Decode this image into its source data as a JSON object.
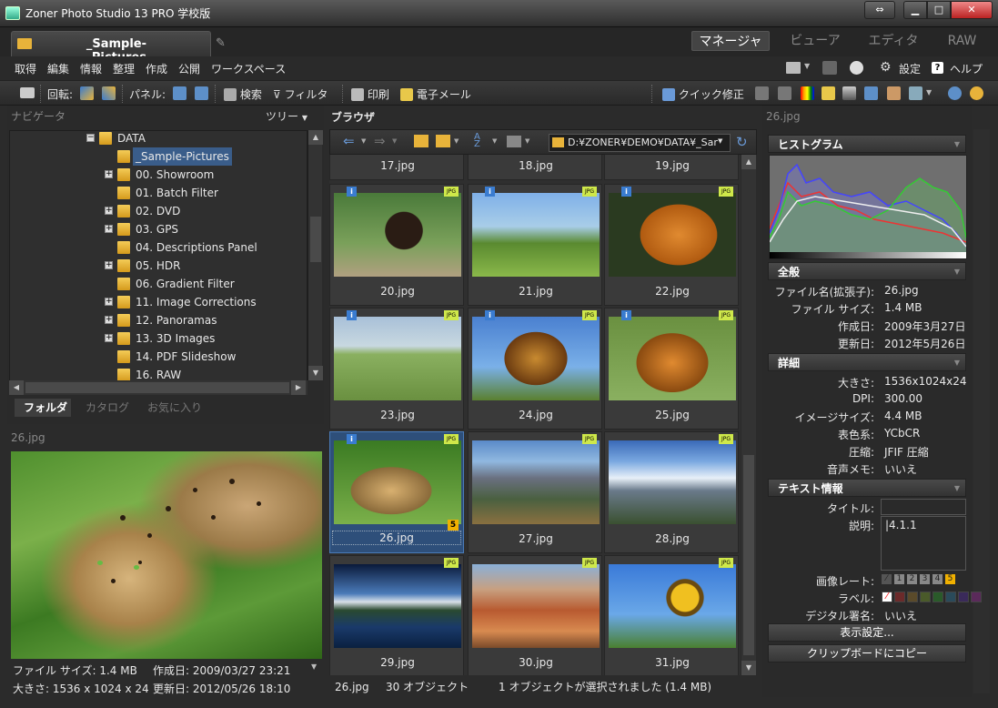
{
  "window": {
    "title": "Zoner Photo Studio 13 PRO 学校版"
  },
  "tab": {
    "label": "_Sample-Pictures"
  },
  "modes": [
    "マネージャ",
    "ビューア",
    "エディタ",
    "RAW"
  ],
  "menu": [
    "取得",
    "編集",
    "情報",
    "整理",
    "作成",
    "公開",
    "ワークスペース"
  ],
  "menu_right": {
    "settings": "設定",
    "help": "ヘルプ"
  },
  "toolbar": {
    "rotate": "回転:",
    "panel": "パネル:",
    "search": "検索",
    "filter": "フィルタ",
    "print": "印刷",
    "email": "電子メール",
    "quickfix": "クイック修正"
  },
  "navigator": {
    "title": "ナビゲータ",
    "tree_label": "ツリー"
  },
  "tree": [
    {
      "label": "DATA",
      "expander": "−",
      "level": 0
    },
    {
      "label": "_Sample-Pictures",
      "expander": "",
      "level": 1,
      "selected": true
    },
    {
      "label": "00. Showroom",
      "expander": "+",
      "level": 1
    },
    {
      "label": "01. Batch Filter",
      "expander": "",
      "level": 1
    },
    {
      "label": "02. DVD",
      "expander": "+",
      "level": 1
    },
    {
      "label": "03. GPS",
      "expander": "+",
      "level": 1
    },
    {
      "label": "04. Descriptions Panel",
      "expander": "",
      "level": 1
    },
    {
      "label": "05. HDR",
      "expander": "+",
      "level": 1
    },
    {
      "label": "06. Gradient Filter",
      "expander": "",
      "level": 1
    },
    {
      "label": "11. Image Corrections",
      "expander": "+",
      "level": 1
    },
    {
      "label": "12. Panoramas",
      "expander": "+",
      "level": 1
    },
    {
      "label": "13. 3D Images",
      "expander": "+",
      "level": 1
    },
    {
      "label": "14. PDF Slideshow",
      "expander": "",
      "level": 1
    },
    {
      "label": "16. RAW",
      "expander": "",
      "level": 1
    }
  ],
  "nav_tabs": [
    "フォルダ",
    "カタログ",
    "お気に入り"
  ],
  "preview": {
    "title": "26.jpg",
    "line1a": "ファイル サイズ: 1.4 MB",
    "line1b": "作成日: 2009/03/27 23:21",
    "line2a": "大きさ: 1536 x 1024 x 24",
    "line2b": "更新日: 2012/05/26 18:10"
  },
  "browser": {
    "title": "ブラウザ",
    "path": "D:¥ZONER¥DEMO¥DATA¥_Sar"
  },
  "top_row": [
    "17.jpg",
    "18.jpg",
    "19.jpg"
  ],
  "thumbnails": [
    {
      "name": "20.jpg",
      "info": true,
      "jpg": true
    },
    {
      "name": "21.jpg",
      "info": true,
      "jpg": true
    },
    {
      "name": "22.jpg",
      "info": true,
      "jpg": true
    },
    {
      "name": "23.jpg",
      "info": true,
      "jpg": true
    },
    {
      "name": "24.jpg",
      "info": true,
      "jpg": true
    },
    {
      "name": "25.jpg",
      "info": true,
      "jpg": true
    },
    {
      "name": "26.jpg",
      "info": true,
      "jpg": true,
      "rating": "5",
      "selected": true
    },
    {
      "name": "27.jpg",
      "info": false,
      "jpg": true
    },
    {
      "name": "28.jpg",
      "info": false,
      "jpg": true
    },
    {
      "name": "29.jpg",
      "info": false,
      "jpg": true
    },
    {
      "name": "30.jpg",
      "info": false,
      "jpg": true
    },
    {
      "name": "31.jpg",
      "info": false,
      "jpg": true
    }
  ],
  "badges": {
    "info": "i",
    "jpg": "JPG"
  },
  "status": {
    "file": "26.jpg",
    "count": "30 オブジェクト",
    "selection": "1 オブジェクトが選択されました (1.4 MB)"
  },
  "right": {
    "title": "26.jpg",
    "histogram": "ヒストグラム",
    "general": {
      "title": "全般",
      "rows": [
        [
          "ファイル名(拡張子):",
          "26.jpg"
        ],
        [
          "ファイル サイズ:",
          "1.4 MB"
        ],
        [
          "作成日:",
          "2009年3月27日"
        ],
        [
          "更新日:",
          "2012年5月26日"
        ]
      ]
    },
    "details": {
      "title": "詳細",
      "rows": [
        [
          "大きさ:",
          "1536x1024x24"
        ],
        [
          "DPI:",
          "300.00"
        ],
        [
          "イメージサイズ:",
          "4.4 MB"
        ],
        [
          "表色系:",
          "YCbCR"
        ],
        [
          "圧縮:",
          "JFIF 圧縮"
        ],
        [
          "音声メモ:",
          "いいえ"
        ]
      ]
    },
    "text": {
      "title": "テキスト情報",
      "title_label": "タイトル:",
      "desc_label": "説明:",
      "desc_value": "|4.1.1"
    },
    "rating_label": "画像レート:",
    "ratings": [
      "1",
      "2",
      "3",
      "4",
      "5"
    ],
    "label_label": "ラベル:",
    "label_colors": [
      "#6b2a2a",
      "#5a4a2a",
      "#4a5a2a",
      "#2a5a2a",
      "#2a4a5a",
      "#3a2a5a",
      "#5a2a5a"
    ],
    "signature_label": "デジタル署名:",
    "signature_value": "いいえ",
    "display_btn": "表示設定...",
    "clipboard_btn": "クリップボードにコピー"
  }
}
